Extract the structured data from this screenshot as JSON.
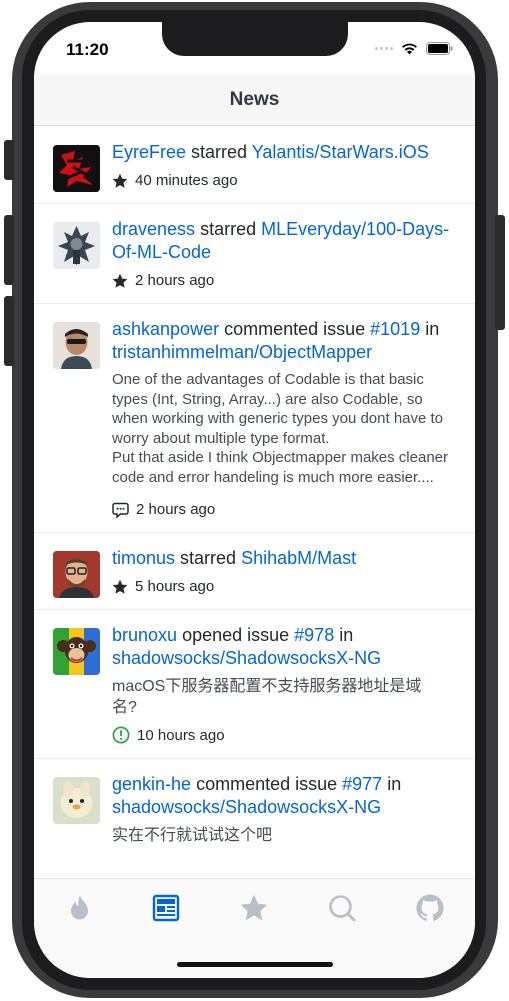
{
  "status": {
    "time": "11:20"
  },
  "navbar": {
    "title": "News"
  },
  "feed": [
    {
      "user": "EyreFree",
      "action": " starred ",
      "target": "Yalantis/StarWars.iOS",
      "time_icon": "star-icon",
      "time": "40 minutes ago"
    },
    {
      "user": "draveness",
      "action": " starred ",
      "target": "MLEveryday/100-Days-Of-ML-Code",
      "time_icon": "star-icon",
      "time": "2 hours ago"
    },
    {
      "user": "ashkanpower",
      "action": " commented issue ",
      "issue": "#1019",
      "in_word": " in ",
      "repo": "tristanhimmelman/ObjectMapper",
      "body": "One of the advantages of Codable is that basic types (Int, String, Array...) are also Codable, so when working with generic types you dont have to worry about multiple type format.\nPut that aside I think Objectmapper makes cleaner code and error handeling is much more easier....",
      "time_icon": "comment-icon",
      "time": "2 hours ago"
    },
    {
      "user": "timonus",
      "action": " starred ",
      "target": "ShihabM/Mast",
      "time_icon": "star-icon",
      "time": "5 hours ago"
    },
    {
      "user": "brunoxu",
      "action": " opened issue ",
      "issue": "#978",
      "in_word": " in ",
      "repo": "shadowsocks/ShadowsocksX-NG",
      "body": "macOS下服务器配置不支持服务器地址是域名?",
      "time_icon": "issue-opened-icon",
      "time": "10 hours ago"
    },
    {
      "user": "genkin-he",
      "action": " commented issue ",
      "issue": "#977",
      "in_word": " in ",
      "repo": "shadowsocks/ShadowsocksX-NG",
      "body": "实在不行就试试这个吧"
    }
  ],
  "tabbar": {
    "tabs": [
      {
        "icon": "flame-icon"
      },
      {
        "icon": "news-icon",
        "active": true
      },
      {
        "icon": "star-icon"
      },
      {
        "icon": "search-icon"
      },
      {
        "icon": "github-icon"
      }
    ]
  },
  "colors": {
    "link": "#0366d6",
    "text": "#24292e",
    "active_tab": "#0366d6",
    "inactive_tab": "#b8bfc7",
    "issue_open": "#28a745"
  }
}
